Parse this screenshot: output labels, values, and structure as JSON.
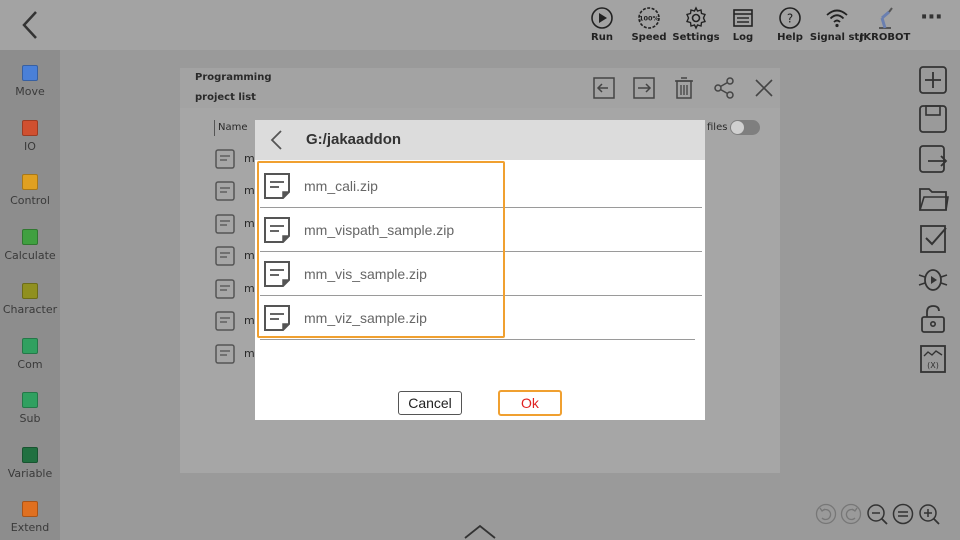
{
  "topbar": {
    "items": [
      {
        "label": "Run",
        "icon": "run-icon"
      },
      {
        "label": "Speed",
        "icon": "speed-icon"
      },
      {
        "label": "Settings",
        "icon": "gear-icon"
      },
      {
        "label": "Log",
        "icon": "log-icon"
      },
      {
        "label": "Help",
        "icon": "help-icon"
      },
      {
        "label": "Signal str",
        "icon": "wifi-icon"
      },
      {
        "label": "JKROBOT",
        "icon": "robot-arm-icon"
      }
    ],
    "speed_value": "100%",
    "more_label": "⋯"
  },
  "sidebar": {
    "items": [
      {
        "label": "Move",
        "color": "#4a80d8"
      },
      {
        "label": "IO",
        "color": "#d05030"
      },
      {
        "label": "Control",
        "color": "#e0a020"
      },
      {
        "label": "Calculate",
        "color": "#40a040"
      },
      {
        "label": "Character",
        "color": "#909020"
      },
      {
        "label": "Com",
        "color": "#30a060"
      },
      {
        "label": "Sub",
        "color": "#30a060"
      },
      {
        "label": "Variable",
        "color": "#207040"
      },
      {
        "label": "Extend",
        "color": "#e07020"
      }
    ]
  },
  "background_panel": {
    "title_line1": "Programming",
    "title_line2": "project list",
    "column_name": "Name",
    "files_label": "files",
    "row_prefix": "m",
    "row_count": 7
  },
  "dialog": {
    "path": "G:/jakaaddon",
    "files": [
      {
        "name": "mm_cali.zip"
      },
      {
        "name": "mm_vispath_sample.zip"
      },
      {
        "name": "mm_vis_sample.zip"
      },
      {
        "name": "mm_viz_sample.zip"
      }
    ],
    "cancel_label": "Cancel",
    "ok_label": "Ok"
  },
  "colors": {
    "accent": "#f0a030",
    "ok_text": "#e02020"
  }
}
